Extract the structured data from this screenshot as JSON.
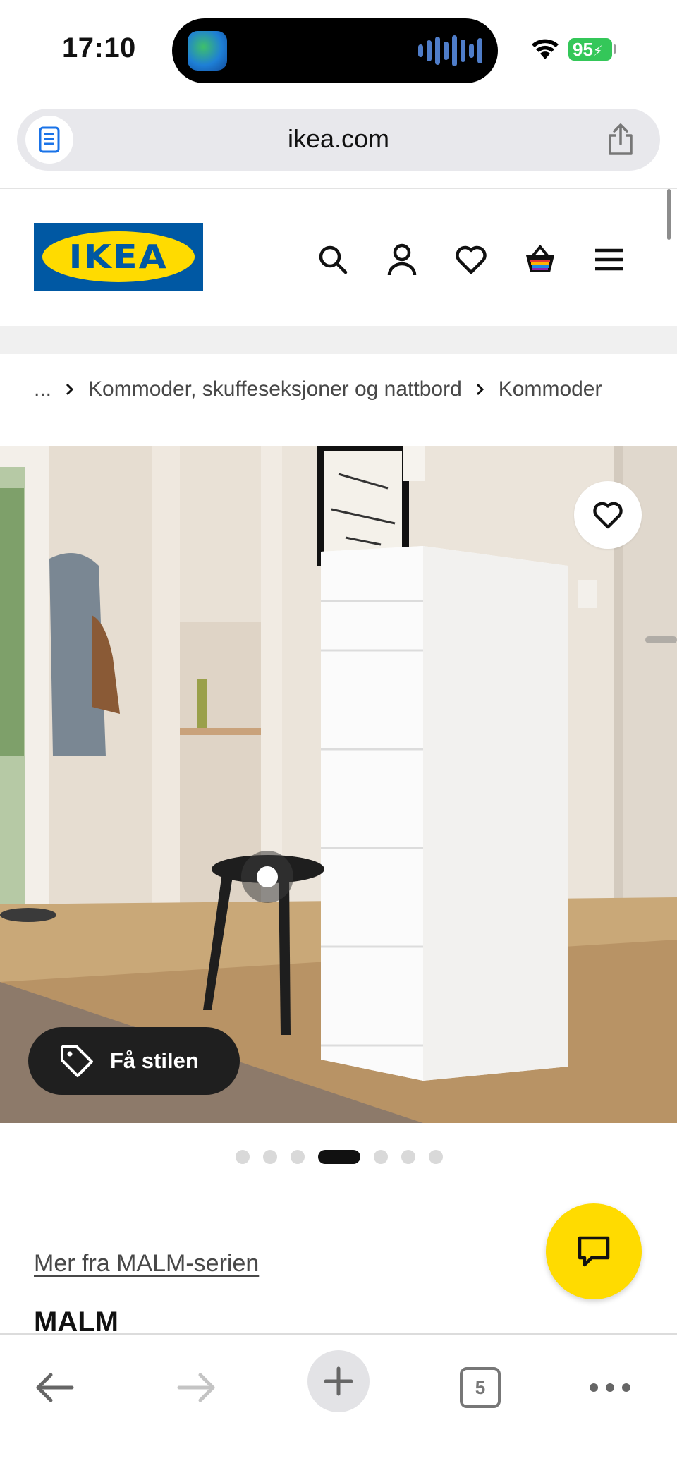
{
  "status_bar": {
    "time": "17:10",
    "battery": "95",
    "icons": [
      "island-app-icon",
      "audio-wave-icon",
      "wifi-icon",
      "battery-icon"
    ]
  },
  "browser": {
    "url": "ikea.com",
    "tabs_count": "5",
    "icons": [
      "reader-icon",
      "share-icon",
      "back-icon",
      "forward-icon",
      "new-tab-icon",
      "tabs-icon",
      "more-icon"
    ]
  },
  "header": {
    "logo_text": "IKEA",
    "icons": [
      "search-icon",
      "account-icon",
      "heart-icon",
      "cart-icon",
      "menu-icon"
    ]
  },
  "breadcrumb": {
    "ellipsis": "...",
    "items": [
      "Kommoder, skuffeseksjoner og nattbord",
      "Kommoder"
    ]
  },
  "gallery": {
    "style_button_label": "Få stilen",
    "dots_total": 7,
    "active_index": 3
  },
  "product": {
    "series_link": "Mer fra MALM-serien",
    "title": "MALM"
  },
  "colors": {
    "ikea_blue": "#0058a3",
    "ikea_yellow": "#ffdb00",
    "battery_green": "#34c759"
  }
}
